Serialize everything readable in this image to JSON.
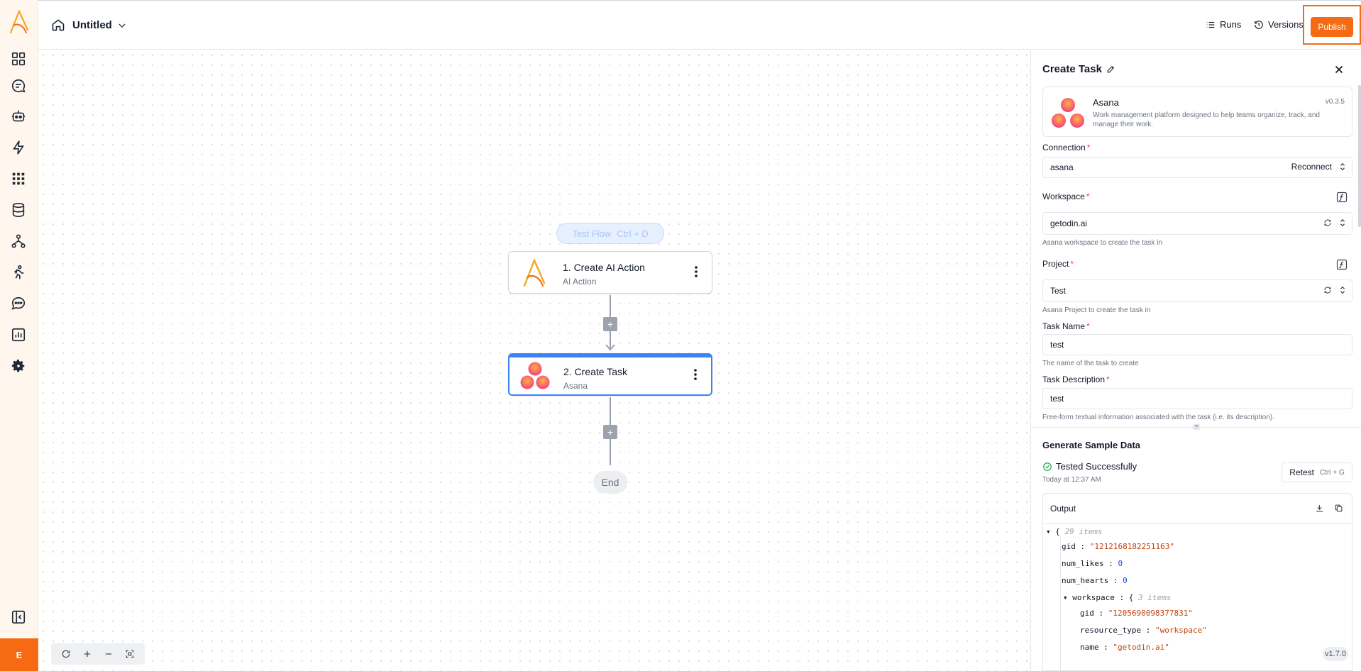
{
  "topbar": {
    "flow_title": "Untitled",
    "runs_label": "Runs",
    "versions_label": "Versions",
    "publish_label": "Publish"
  },
  "sidebar": {
    "items": [
      "dashboard-icon",
      "chat-icon",
      "bot-icon",
      "flash-icon",
      "apps-grid-icon",
      "database-icon",
      "flow-icon",
      "run-icon",
      "message-icon",
      "chart-icon",
      "settings-icon"
    ],
    "collapse_icon": "collapse-panel-icon",
    "user_initial": "E"
  },
  "canvas": {
    "test_flow_label": "Test Flow",
    "test_flow_shortcut": "Ctrl + D",
    "nodes": [
      {
        "title": "1. Create AI Action",
        "subtitle": "AI Action"
      },
      {
        "title": "2. Create Task",
        "subtitle": "Asana"
      }
    ],
    "end_label": "End",
    "plus_symbol": "+"
  },
  "panel": {
    "title": "Create Task",
    "piece": {
      "name": "Asana",
      "version": "v0.3.5",
      "description": "Work management platform designed to help teams organize, track, and manage their work."
    },
    "connection": {
      "label": "Connection",
      "value": "asana",
      "action": "Reconnect"
    },
    "workspace": {
      "label": "Workspace",
      "value": "getodin.ai",
      "help": "Asana workspace to create the task in"
    },
    "project": {
      "label": "Project",
      "value": "Test",
      "help": "Asana Project to create the task in"
    },
    "task_name": {
      "label": "Task Name",
      "value": "test",
      "help": "The name of the task to create"
    },
    "task_description": {
      "label": "Task Description",
      "value": "test",
      "help": "Free-form textual information associated with the task (i.e. its description)."
    },
    "required_mark": "*",
    "sample": {
      "title": "Generate Sample Data",
      "status": "Tested Successfully",
      "time": "Today at 12:37 AM",
      "retest_label": "Retest",
      "retest_shortcut": "Ctrl + G",
      "output_label": "Output"
    },
    "json": {
      "root_meta": "29 items",
      "gid_key": "gid",
      "gid_val": "\"1212168182251163\"",
      "num_likes_key": "num_likes",
      "num_likes_val": "0",
      "num_hearts_key": "num_hearts",
      "num_hearts_val": "0",
      "workspace_key": "workspace",
      "workspace_meta": "3 items",
      "ws_gid_key": "gid",
      "ws_gid_val": "\"1205690098377831\"",
      "ws_type_key": "resource_type",
      "ws_type_val": "\"workspace\"",
      "ws_name_key": "name",
      "ws_name_val": "\"getodin.ai\""
    }
  },
  "version_badge": "v1.7.0",
  "colors": {
    "accent": "#f56a12",
    "selected": "#3b82f6"
  }
}
